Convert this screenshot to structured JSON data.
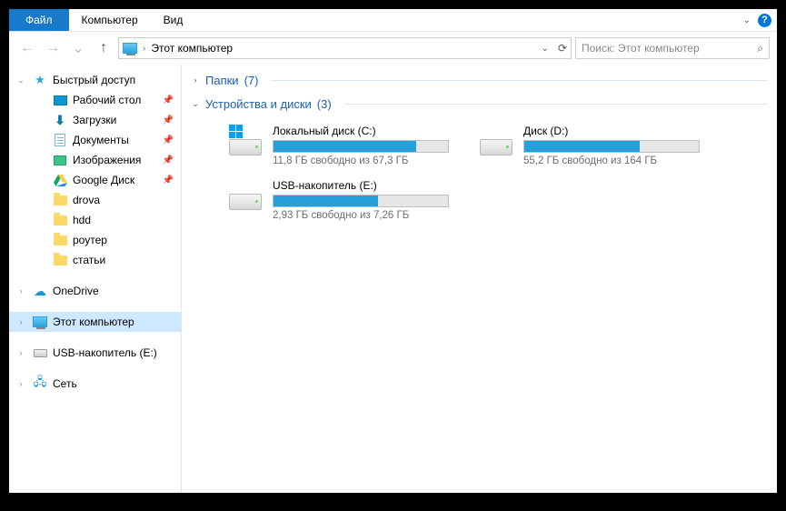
{
  "menubar": {
    "file": "Файл",
    "computer": "Компьютер",
    "view": "Вид"
  },
  "address": {
    "location": "Этот компьютер"
  },
  "search": {
    "placeholder": "Поиск: Этот компьютер"
  },
  "sidebar": {
    "quick_access": "Быстрый доступ",
    "desktop": "Рабочий стол",
    "downloads": "Загрузки",
    "documents": "Документы",
    "pictures": "Изображения",
    "google_drive": "Google Диск",
    "drova": "drova",
    "hdd": "hdd",
    "router": "роутер",
    "articles": "статьи",
    "onedrive": "OneDrive",
    "this_pc": "Этот компьютер",
    "usb": "USB-накопитель (E:)",
    "network": "Сеть"
  },
  "groups": {
    "folders": {
      "label": "Папки",
      "count": "(7)"
    },
    "devices": {
      "label": "Устройства и диски",
      "count": "(3)"
    }
  },
  "drives": [
    {
      "name": "Локальный диск (C:)",
      "free_text": "11,8 ГБ свободно из 67,3 ГБ",
      "fill_percent": 82,
      "os_badge": true
    },
    {
      "name": "Диск (D:)",
      "free_text": "55,2 ГБ свободно из 164 ГБ",
      "fill_percent": 66,
      "os_badge": false
    },
    {
      "name": "USB-накопитель (E:)",
      "free_text": "2,93 ГБ свободно из 7,26 ГБ",
      "fill_percent": 60,
      "os_badge": false
    }
  ]
}
